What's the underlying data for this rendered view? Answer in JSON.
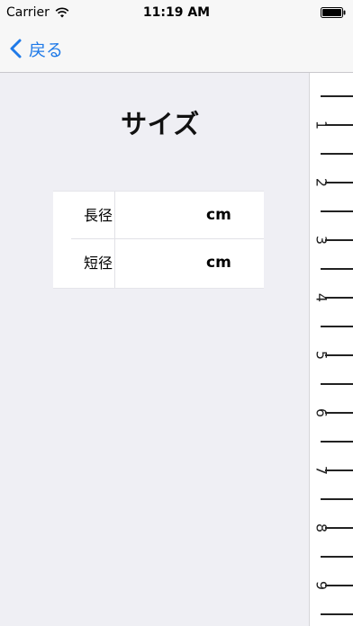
{
  "status_bar": {
    "carrier": "Carrier",
    "time": "11:19 AM"
  },
  "nav": {
    "back_label": "戻る"
  },
  "page": {
    "title": "サイズ"
  },
  "size_form": {
    "rows": [
      {
        "label": "長径",
        "value": "",
        "unit": "cm"
      },
      {
        "label": "短径",
        "value": "",
        "unit": "cm"
      }
    ]
  },
  "ruler": {
    "numbers": [
      "1",
      "2",
      "3",
      "4",
      "5",
      "6",
      "7",
      "8",
      "9"
    ]
  },
  "colors": {
    "accent": "#1f7ae8",
    "background": "#efeff4",
    "bar": "#f7f7f7"
  }
}
